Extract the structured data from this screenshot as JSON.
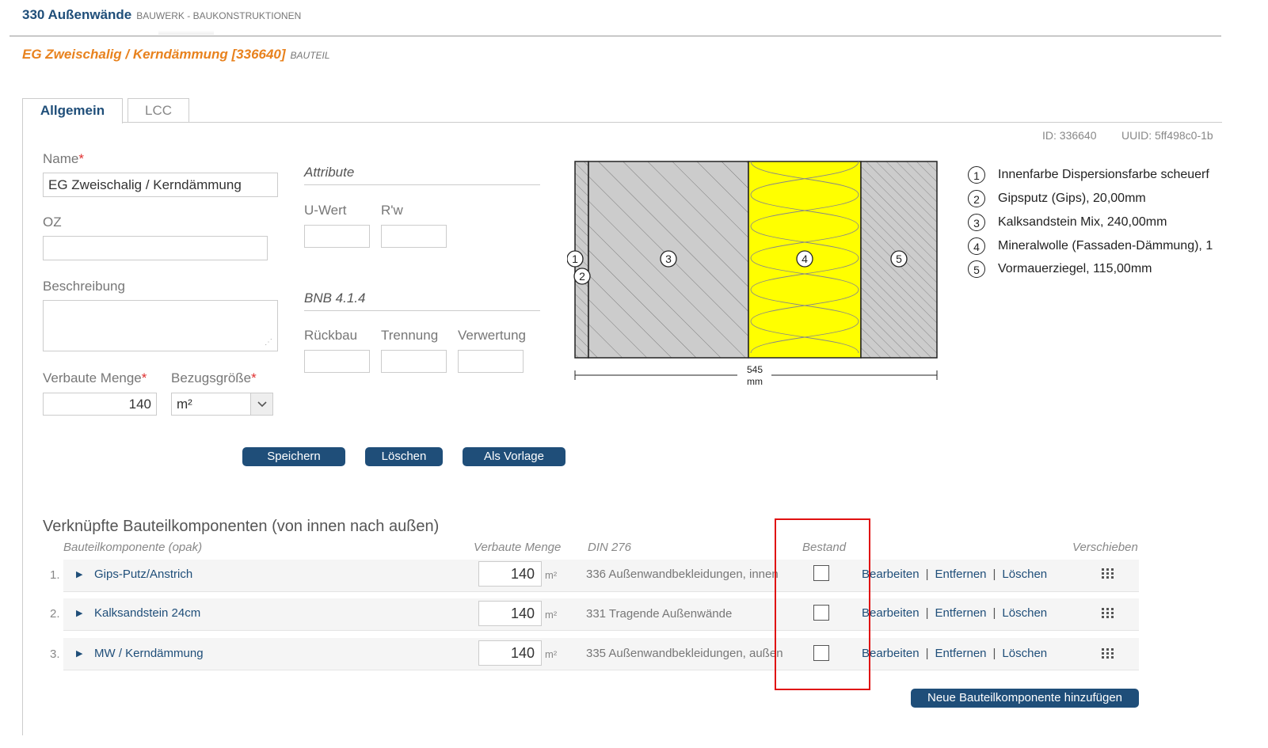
{
  "header": {
    "title": "330 Außenwände",
    "subtitle": "BAUWERK - BAUKONSTRUKTIONEN"
  },
  "element": {
    "title": "EG Zweischalig / Kerndämmung [336640]",
    "label": "BAUTEIL"
  },
  "tabs": [
    {
      "label": "Allgemein",
      "active": true
    },
    {
      "label": "LCC",
      "active": false
    }
  ],
  "meta": {
    "id": "ID: 336640",
    "uuid": "UUID: 5ff498c0-1b"
  },
  "form": {
    "name_label": "Name",
    "required_mark": "*",
    "name_value": "EG Zweischalig / Kerndämmung",
    "oz_label": "OZ",
    "oz_value": "",
    "beschreibung_label": "Beschreibung",
    "beschreibung_value": "",
    "menge_label": "Verbaute Menge",
    "menge_value": "140",
    "bezug_label": "Bezugsgröße",
    "bezug_value": "m²"
  },
  "attribute": {
    "heading": "Attribute",
    "uwert_label": "U-Wert",
    "uwert_value": "",
    "rw_label": "R'w",
    "rw_value": ""
  },
  "bnb": {
    "heading": "BNB 4.1.4",
    "rueckbau_label": "Rückbau",
    "trennung_label": "Trennung",
    "verwertung_label": "Verwertung"
  },
  "buttons": {
    "save": "Speichern",
    "delete": "Löschen",
    "template": "Als Vorlage",
    "add_component": "Neue Bauteilkomponente hinzufügen"
  },
  "diagram": {
    "layer_numbers": [
      "1",
      "2",
      "3",
      "4",
      "5"
    ],
    "dimension_value": "545",
    "dimension_unit": "mm",
    "insulation_color": "#ffff00",
    "hatch_fill_color": "#cccccc"
  },
  "legend": [
    {
      "num": "1",
      "text": "Innenfarbe Dispersionsfarbe scheuerf"
    },
    {
      "num": "2",
      "text": "Gipsputz (Gips), 20,00mm"
    },
    {
      "num": "3",
      "text": "Kalksandstein Mix, 240,00mm"
    },
    {
      "num": "4",
      "text": "Mineralwolle (Fassaden-Dämmung), 1"
    },
    {
      "num": "5",
      "text": "Vormauerziegel, 115,00mm"
    }
  ],
  "components": {
    "title": "Verknüpfte Bauteilkomponenten (von innen nach außen)",
    "col_component": "Bauteilkomponente (opak)",
    "col_menge": "Verbaute Menge",
    "col_din": "DIN 276",
    "col_bestand": "Bestand",
    "col_move": "Verschieben",
    "rows": [
      {
        "num": "1.",
        "name": "Gips-Putz/Anstrich",
        "qty": "140",
        "unit": "m²",
        "din": "336  Außenwandbekleidungen, innen",
        "bestand": false
      },
      {
        "num": "2.",
        "name": "Kalksandstein 24cm",
        "qty": "140",
        "unit": "m²",
        "din": "331  Tragende Außenwände",
        "bestand": false
      },
      {
        "num": "3.",
        "name": "MW / Kerndämmung",
        "qty": "140",
        "unit": "m²",
        "din": "335  Außenwandbekleidungen, außen",
        "bestand": false
      }
    ],
    "action_edit": "Bearbeiten",
    "action_remove": "Entfernen",
    "action_delete": "Löschen",
    "separator": "|",
    "highlight_color": "#e01010"
  }
}
